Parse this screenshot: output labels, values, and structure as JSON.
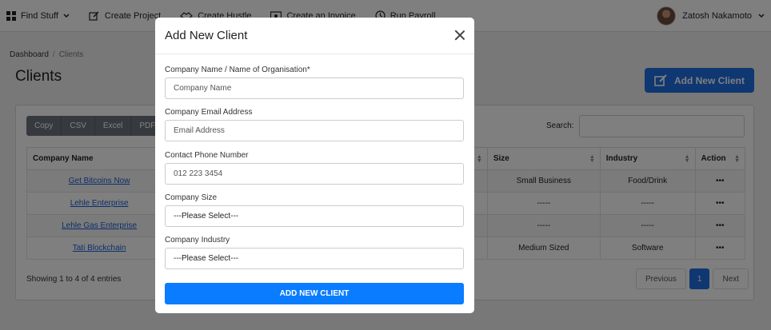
{
  "nav": {
    "items": [
      {
        "label": "Find Stuff"
      },
      {
        "label": "Create Project"
      },
      {
        "label": "Create Hustle"
      },
      {
        "label": "Create an Invoice"
      },
      {
        "label": "Run Payroll"
      }
    ],
    "user_name": "Zatosh Nakamoto"
  },
  "breadcrumb": {
    "home": "Dashboard",
    "current": "Clients"
  },
  "page_title": "Clients",
  "add_client_button": "Add New Client",
  "export_buttons": [
    "Copy",
    "CSV",
    "Excel",
    "PDF"
  ],
  "search_label": "Search:",
  "table": {
    "columns": [
      "Company Name",
      "Size",
      "Industry",
      "Action"
    ],
    "rows": [
      {
        "name": "Get Bitcoins Now",
        "size": "Small Business",
        "industry": "Food/Drink",
        "action": "•••"
      },
      {
        "name": "Lehle Enterprise",
        "size": "-----",
        "industry": "-----",
        "action": "•••"
      },
      {
        "name": "Lehle Gas Enterprise",
        "size": "-----",
        "industry": "-----",
        "action": "•••"
      },
      {
        "name": "Tati Blockchain",
        "size": "Medium Sized",
        "industry": "Software",
        "action": "•••"
      }
    ]
  },
  "showing_text": "Showing 1 to 4 of 4 entries",
  "pagination": {
    "previous": "Previous",
    "page": "1",
    "next": "Next"
  },
  "modal": {
    "title": "Add New Client",
    "fields": {
      "company_name": {
        "label": "Company Name / Name of Organisation*",
        "placeholder": "Company Name"
      },
      "email": {
        "label": "Company Email Address",
        "placeholder": "Email Address"
      },
      "phone": {
        "label": "Contact Phone Number",
        "placeholder": "012 223 3454"
      },
      "size": {
        "label": "Company Size",
        "value": "---Please Select---"
      },
      "industry": {
        "label": "Company Industry",
        "value": "---Please Select---"
      }
    },
    "submit": "ADD NEW CLIENT"
  }
}
